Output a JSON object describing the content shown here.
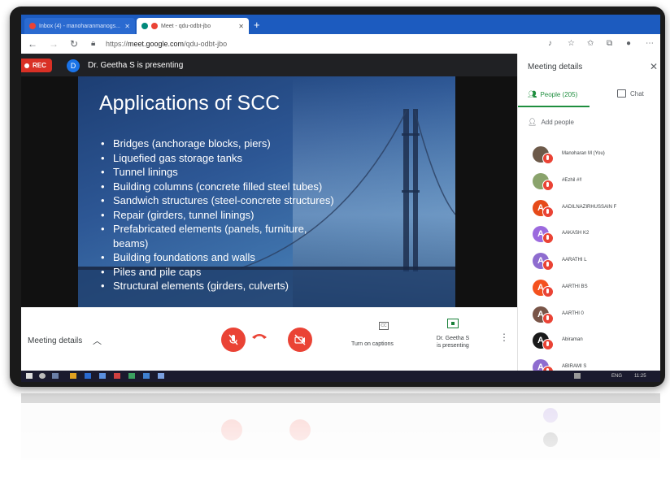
{
  "browser": {
    "tabs": [
      {
        "label": "Inbox (4) - manoharanmanogs..."
      },
      {
        "label": "Meet - qdu-odbt-jbo"
      }
    ],
    "new_tab_symbol": "+",
    "url_prefix": "https://",
    "url_host": "meet.google.com",
    "url_path": "/qdu-odbt-jbo"
  },
  "meet": {
    "rec_label": "REC",
    "presenter_initial": "D",
    "presenting_text": "Dr. Geetha S is presenting"
  },
  "slide": {
    "title": "Applications of SCC",
    "bullets": [
      {
        "text": "Bridges (anchorage blocks, piers)",
        "bullet": true
      },
      {
        "text": "Liquefied gas storage tanks",
        "bullet": true
      },
      {
        "text": "Tunnel linings",
        "bullet": true
      },
      {
        "text": "Building columns (concrete filled steel tubes)",
        "bullet": true
      },
      {
        "text": "Sandwich structures (steel-concrete structures)",
        "bullet": true
      },
      {
        "text": "Repair (girders, tunnel linings)",
        "bullet": true
      },
      {
        "text": "Prefabricated elements (panels, furniture,",
        "bullet": true
      },
      {
        "text": "beams)",
        "bullet": false
      },
      {
        "text": "Building foundations and walls",
        "bullet": true
      },
      {
        "text": "Piles and pile caps",
        "bullet": true
      },
      {
        "text": "Structural elements (girders, culverts)",
        "bullet": true
      }
    ]
  },
  "controls": {
    "meeting_details_label": "Meeting details",
    "captions_icon_text": "CC",
    "captions_label": "Turn on captions",
    "presenting_label_line1": "Dr. Geetha S",
    "presenting_label_line2": "is presenting",
    "mic_color": "#ea4335",
    "hangup_color": "#ea4335"
  },
  "panel": {
    "title": "Meeting details",
    "people_tab": "People (205)",
    "chat_tab": "Chat",
    "add_people": "Add people",
    "participants": [
      {
        "name": "Manoharan M (You)",
        "initial": "",
        "color": "#6d5a4a"
      },
      {
        "name": "#Ezhil #!!",
        "initial": "",
        "color": "#8aa36c"
      },
      {
        "name": "AADILNAZIRHUSSAIN F",
        "initial": "A",
        "color": "#e64a19"
      },
      {
        "name": "AAKASH K2",
        "initial": "A",
        "color": "#9c6ade"
      },
      {
        "name": "AARATHI L",
        "initial": "A",
        "color": "#8e6ccf"
      },
      {
        "name": "AARTHI BS",
        "initial": "A",
        "color": "#f4511e"
      },
      {
        "name": "AARTHI 0",
        "initial": "A",
        "color": "#795548"
      },
      {
        "name": "Abiraman",
        "initial": "A",
        "color": "#1a1a1a"
      },
      {
        "name": "ABIRAMI S",
        "initial": "A",
        "color": "#8e6ccf"
      }
    ]
  },
  "taskbar": {
    "lang": "ENG",
    "time": "11:25"
  }
}
